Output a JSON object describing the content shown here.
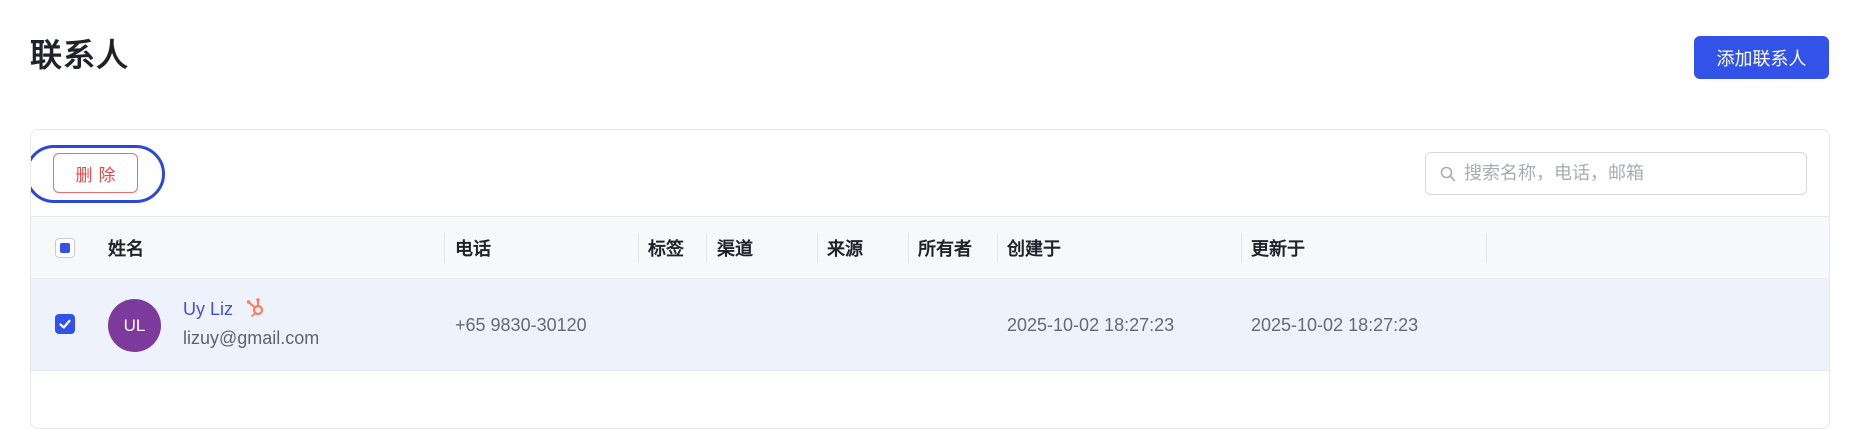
{
  "page": {
    "title": "联系人",
    "add_button": "添加联系人"
  },
  "toolbar": {
    "delete_label": "删除",
    "search_placeholder": "搜索名称，电话，邮箱"
  },
  "table": {
    "columns": [
      "姓名",
      "电话",
      "标签",
      "渠道",
      "来源",
      "所有者",
      "创建于",
      "更新于"
    ],
    "rows": [
      {
        "selected": true,
        "avatar_initials": "UL",
        "avatar_color": "#7b3a9c",
        "name": "Uy Liz",
        "source_icon": "hubspot-icon",
        "email": "lizuy@gmail.com",
        "phone": "+65 9830-30120",
        "tags": "",
        "channel": "",
        "source": "",
        "owner": "",
        "created_at": "2025-10-02 18:27:23",
        "updated_at": "2025-10-02 18:27:23"
      }
    ]
  },
  "colors": {
    "primary": "#3352e8",
    "danger": "#e84b4b",
    "selected_row": "#eef2fd",
    "hubspot": "#ff7a59"
  }
}
